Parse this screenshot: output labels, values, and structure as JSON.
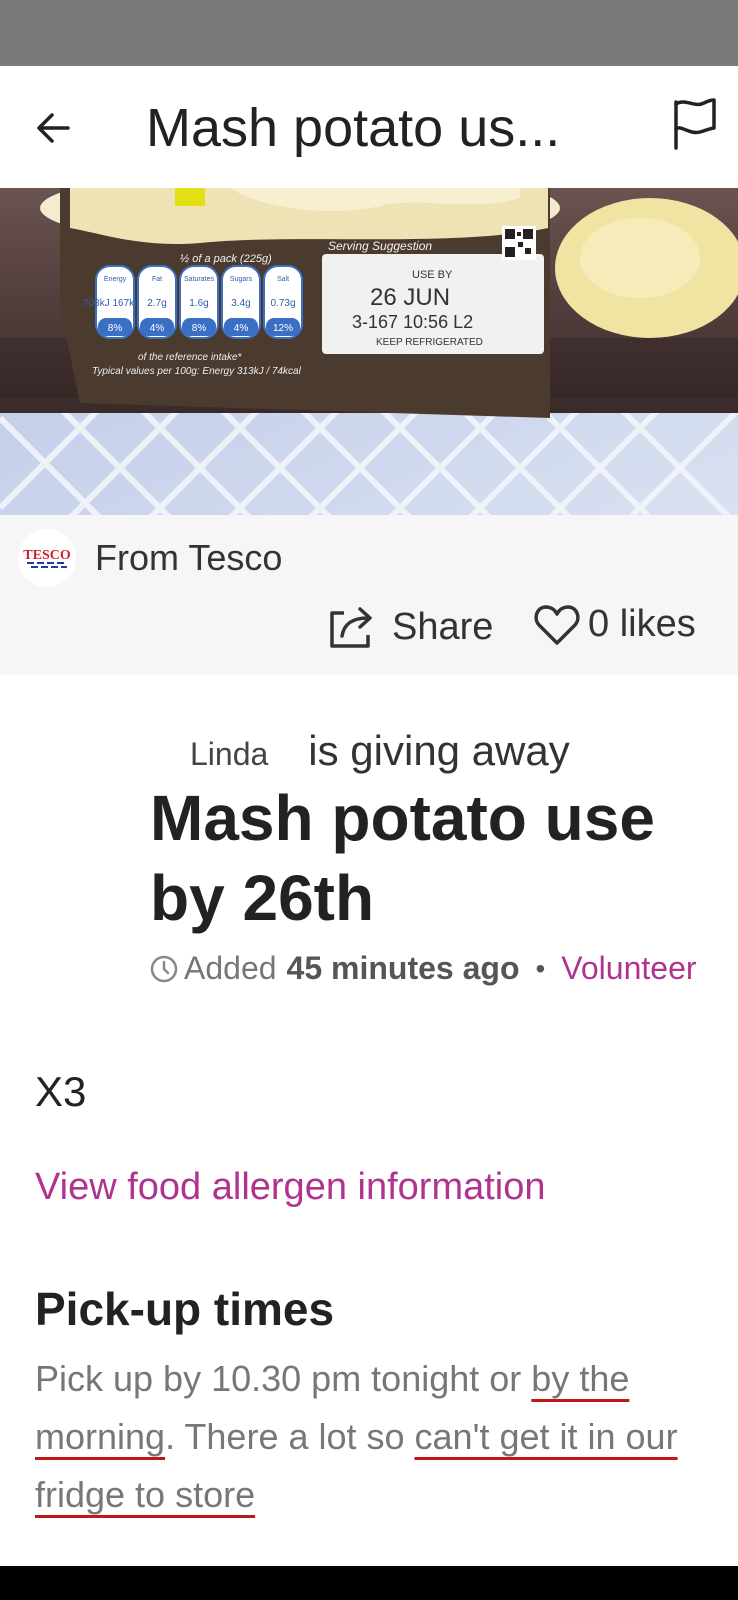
{
  "app_bar": {
    "title": "Mash potato us..."
  },
  "photo": {
    "pack_line": "½ of a pack (225g)",
    "nutrition": [
      {
        "name": "Energy",
        "amount": "703kJ 167kcal",
        "pct": "8%"
      },
      {
        "name": "Fat",
        "amount": "2.7g",
        "pct": "4%"
      },
      {
        "name": "Saturates",
        "amount": "1.6g",
        "pct": "8%"
      },
      {
        "name": "Sugars",
        "amount": "3.4g",
        "pct": "4%"
      },
      {
        "name": "Salt",
        "amount": "0.73g",
        "pct": "12%"
      }
    ],
    "ref_intake": "of the reference intake*",
    "typical": "Typical values per 100g: Energy 313kJ / 74kcal",
    "serving": "Serving Suggestion",
    "use_by": "USE BY",
    "date": "26 JUN",
    "code": "3-167 10:56 L2",
    "keep": "KEEP REFRIGERATED"
  },
  "store": {
    "logo_text": "TESCO",
    "label": "From Tesco"
  },
  "actions": {
    "share": "Share",
    "likes": "0 likes"
  },
  "listing": {
    "giver": "Linda",
    "action": "is giving away",
    "title": "Mash potato use by 26th",
    "added_label": "Added",
    "added_time": "45 minutes ago",
    "separator": "•",
    "volunteer": "Volunteer"
  },
  "description": {
    "quantity": "X3"
  },
  "allergen_link": "View food allergen information",
  "pickup": {
    "heading": "Pick-up times",
    "text_1": "Pick up by 10.30 pm  tonight or ",
    "text_2": "by the morning",
    "text_3": ". There a lot so ",
    "text_4": "can't get it in our fridge to store"
  },
  "colors": {
    "accent": "#b0338f",
    "status_bar": "#7a7a7a",
    "store_bg": "#f6f6f6"
  }
}
